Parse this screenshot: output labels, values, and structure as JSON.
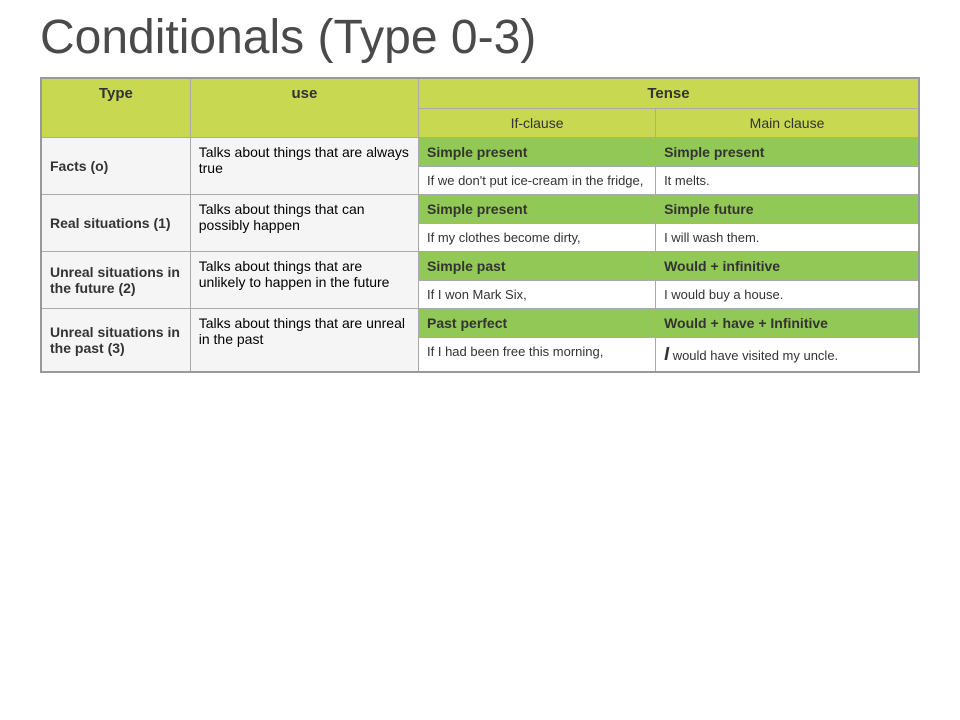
{
  "title": "Conditionals (Type 0-3)",
  "table": {
    "headers": {
      "col1": "Type",
      "col2": "use",
      "tense": "Tense",
      "ifClause": "If-clause",
      "mainClause": "Main clause"
    },
    "sections": [
      {
        "type": "Facts (o)",
        "use": "Talks about things that are always true",
        "ifClauseHeader": "Simple present",
        "mainClauseHeader": "Simple present",
        "ifExample": "If we don't put ice-cream in the fridge,",
        "mainExample": "It melts."
      },
      {
        "type": "Real situations (1)",
        "use": "Talks about things that can possibly happen",
        "ifClauseHeader": "Simple present",
        "mainClauseHeader": "Simple future",
        "ifExample": "If my clothes become dirty,",
        "mainExample": "I will wash them."
      },
      {
        "type": "Unreal situations in the future (2)",
        "use": "Talks about things that are unlikely to happen in the future",
        "ifClauseHeader": "Simple past",
        "mainClauseHeader": "Would + infinitive",
        "ifExample": "If I won Mark Six,",
        "mainExample": "I would buy a house."
      },
      {
        "type": "Unreal situations in the past (3)",
        "use": "Talks about things that are unreal in the past",
        "ifClauseHeader": "Past perfect",
        "mainClauseHeader": "Would + have + Infinitive",
        "ifExample": "If I had been free this morning,",
        "mainExampleItalic": "I",
        "mainExample": " would have visited my uncle."
      }
    ]
  }
}
